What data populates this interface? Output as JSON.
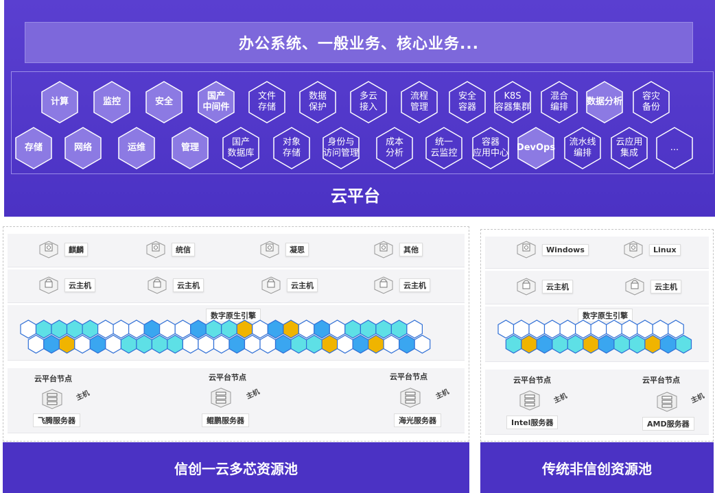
{
  "banner_text": "办公系统、一般业务、核心业务...",
  "platform_title": "云平台",
  "hex_row1": [
    {
      "label": "计算",
      "bold": true
    },
    {
      "label": "监控",
      "bold": true
    },
    {
      "label": "安全",
      "bold": true
    },
    {
      "label": "国产\n中间件",
      "bold": true
    },
    {
      "label": "文件\n存储",
      "bold": false
    },
    {
      "label": "数据\n保护",
      "bold": false
    },
    {
      "label": "多云\n接入",
      "bold": false
    },
    {
      "label": "流程\n管理",
      "bold": false
    },
    {
      "label": "安全\n容器",
      "bold": false
    },
    {
      "label": "K8S\n容器集群",
      "bold": false
    },
    {
      "label": "混合\n编排",
      "bold": false
    },
    {
      "label": "数据分析",
      "bold": true
    },
    {
      "label": "容灾\n备份",
      "bold": false
    }
  ],
  "hex_row2": [
    {
      "label": "存储",
      "bold": true
    },
    {
      "label": "网络",
      "bold": true
    },
    {
      "label": "运维",
      "bold": true
    },
    {
      "label": "管理",
      "bold": true
    },
    {
      "label": "国产\n数据库",
      "bold": false
    },
    {
      "label": "对象\n存储",
      "bold": false
    },
    {
      "label": "身份与\n访问管理",
      "bold": false
    },
    {
      "label": "成本\n分析",
      "bold": false
    },
    {
      "label": "统一\n云监控",
      "bold": false
    },
    {
      "label": "容器\n应用中心",
      "bold": false
    },
    {
      "label": "DevOps",
      "bold": true
    },
    {
      "label": "流水线\n编排",
      "bold": false
    },
    {
      "label": "云应用\n集成",
      "bold": false
    },
    {
      "label": "...",
      "bold": false
    }
  ],
  "left_pool": {
    "os": [
      "麒麟",
      "统信",
      "凝思",
      "其他"
    ],
    "vm_label": "云主机",
    "engine_label": "数字原生引擎",
    "node_label": "云平台节点",
    "host_label": "主机",
    "servers": [
      "飞腾服务器",
      "鲲鹏服务器",
      "海光服务器"
    ],
    "footer": "信创一云多芯资源池"
  },
  "right_pool": {
    "os": [
      "Windows",
      "Linux"
    ],
    "vm_label": "云主机",
    "engine_label": "数字原生引擎",
    "node_label": "云平台节点",
    "host_label": "主机",
    "servers": [
      "Intel服务器",
      "AMD服务器"
    ],
    "footer": "传统非信创资源池"
  },
  "colors": {
    "platform": "#4b32c4",
    "banner": "#7d68db",
    "hex_light": "#8c7ae3",
    "engine_white": "#ffffff",
    "engine_cyan": "#5ee0e6",
    "engine_blue": "#3aa6f0",
    "engine_gold": "#f0b400",
    "engine_stroke": "#2f6fd6"
  }
}
